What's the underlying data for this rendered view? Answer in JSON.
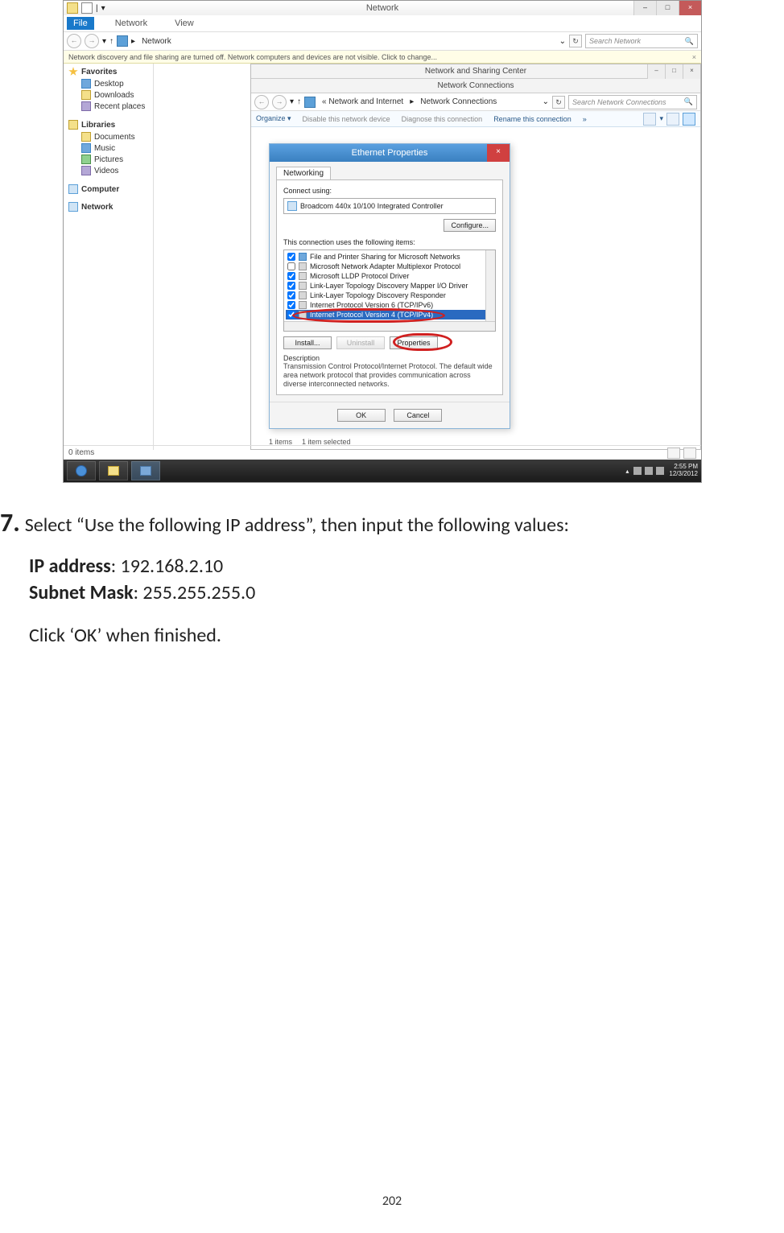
{
  "explorer": {
    "title": "Network",
    "tabs": {
      "file": "File",
      "network": "Network",
      "view": "View"
    },
    "breadcrumb": "Network",
    "search_placeholder": "Search Network",
    "info_bar": "Network discovery and file sharing are turned off. Network computers and devices are not visible. Click to change...",
    "sidebar": {
      "favorites": {
        "head": "Favorites",
        "items": [
          "Desktop",
          "Downloads",
          "Recent places"
        ]
      },
      "libraries": {
        "head": "Libraries",
        "items": [
          "Documents",
          "Music",
          "Pictures",
          "Videos"
        ]
      },
      "computer": {
        "head": "Computer"
      },
      "network": {
        "head": "Network"
      }
    },
    "status": "0 items"
  },
  "ns_window": {
    "title": "Network and Sharing Center"
  },
  "nc_window": {
    "title": "Network Connections",
    "breadcrumb_prefix": "« Network and Internet",
    "breadcrumb_current": "Network Connections",
    "search_placeholder": "Search Network Connections",
    "toolbar": {
      "organize": "Organize ▾",
      "disable": "Disable this network device",
      "diagnose": "Diagnose this connection",
      "rename": "Rename this connection",
      "more": "»"
    },
    "status_items": "1 items",
    "status_selected": "1 item selected"
  },
  "dialog": {
    "title": "Ethernet Properties",
    "tab": "Networking",
    "connect_label": "Connect using:",
    "adapter": "Broadcom 440x 10/100 Integrated Controller",
    "configure_btn": "Configure...",
    "items_label": "This connection uses the following items:",
    "items": [
      {
        "checked": true,
        "label": "File and Printer Sharing for Microsoft Networks"
      },
      {
        "checked": false,
        "label": "Microsoft Network Adapter Multiplexor Protocol"
      },
      {
        "checked": true,
        "label": "Microsoft LLDP Protocol Driver"
      },
      {
        "checked": true,
        "label": "Link-Layer Topology Discovery Mapper I/O Driver"
      },
      {
        "checked": true,
        "label": "Link-Layer Topology Discovery Responder"
      },
      {
        "checked": true,
        "label": "Internet Protocol Version 6 (TCP/IPv6)"
      },
      {
        "checked": true,
        "label": "Internet Protocol Version 4 (TCP/IPv4)"
      }
    ],
    "install_btn": "Install...",
    "uninstall_btn": "Uninstall",
    "properties_btn": "Properties",
    "desc_head": "Description",
    "desc_body": "Transmission Control Protocol/Internet Protocol. The default wide area network protocol that provides communication across diverse interconnected networks.",
    "ok_btn": "OK",
    "cancel_btn": "Cancel"
  },
  "taskbar": {
    "time": "2:55 PM",
    "date": "12/3/2012"
  },
  "instruction": {
    "num": "7.",
    "text": "Select “Use the following IP address”, then input the following values:",
    "ip_label": "IP address",
    "ip_value": ": 192.168.2.10",
    "mask_label": "Subnet Mask",
    "mask_value": ": 255.255.255.0",
    "click_ok": "Click ‘OK’ when finished."
  },
  "page_number": "202"
}
